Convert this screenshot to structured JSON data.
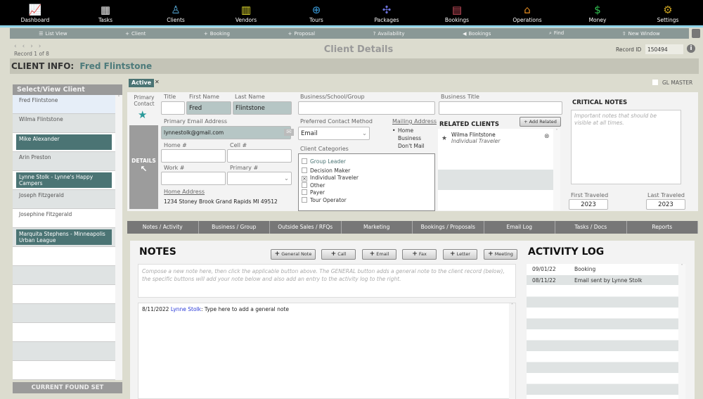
{
  "nav": [
    {
      "label": "Dashboard",
      "icon": "chart-icon",
      "color": "#ddd",
      "glyph": "📈"
    },
    {
      "label": "Tasks",
      "icon": "calendar-icon",
      "color": "#eee",
      "glyph": "▦"
    },
    {
      "label": "Clients",
      "icon": "person-icon",
      "color": "#5ab0e0",
      "glyph": "♙"
    },
    {
      "label": "Vendors",
      "icon": "building-icon",
      "color": "#e6e030",
      "glyph": "▥"
    },
    {
      "label": "Tours",
      "icon": "globe-icon",
      "color": "#3a9ad8",
      "glyph": "⊕"
    },
    {
      "label": "Packages",
      "icon": "puzzle-icon",
      "color": "#6a70d8",
      "glyph": "✣"
    },
    {
      "label": "Bookings",
      "icon": "ticket-icon",
      "color": "#d05060",
      "glyph": "▤"
    },
    {
      "label": "Operations",
      "icon": "house-icon",
      "color": "#e08a20",
      "glyph": "⌂"
    },
    {
      "label": "Money",
      "icon": "coin-icon",
      "color": "#30c050",
      "glyph": "$"
    },
    {
      "label": "Settings",
      "icon": "gears-icon",
      "color": "#c8a020",
      "glyph": "⚙"
    }
  ],
  "toolbar": [
    {
      "label": "List View",
      "glyph": "☰"
    },
    {
      "label": "Client",
      "glyph": "+"
    },
    {
      "label": "Booking",
      "glyph": "+"
    },
    {
      "label": "Proposal",
      "glyph": "+"
    },
    {
      "label": "Availability",
      "glyph": "?"
    },
    {
      "label": "Bookings",
      "glyph": "◀"
    },
    {
      "label": "Find",
      "glyph": "⌕"
    },
    {
      "label": "New Window",
      "glyph": "⇧"
    }
  ],
  "header": {
    "record": "Record 1 of 8",
    "title": "Client Details",
    "record_id_label": "Record ID",
    "record_id": "150494",
    "client_info_label": "CLIENT INFO:",
    "client_name": "Fred Flintstone"
  },
  "list": {
    "title": "Select/View Client",
    "footer": "CURRENT FOUND SET",
    "items": [
      {
        "name": "Fred Flintstone",
        "hl": false
      },
      {
        "name": "Wilma Flintstone",
        "hl": false
      },
      {
        "name": "Mike Alexander",
        "hl": true
      },
      {
        "name": "Arin Preston",
        "hl": false
      },
      {
        "name": "Lynne Stolk - Lynne's Happy Campers",
        "hl": true
      },
      {
        "name": "Joseph Fitzgerald",
        "hl": false
      },
      {
        "name": "Josephine Fitzgerald",
        "hl": false
      },
      {
        "name": "Marquita Stephens - Minneapolis Urban League",
        "hl": true
      }
    ]
  },
  "form": {
    "status": "Active",
    "gl_master": "GL MASTER",
    "primary_contact": "Primary Contact",
    "details": "DETAILS",
    "title_label": "Title",
    "title": "",
    "first_label": "First Name",
    "first": "Fred",
    "last_label": "Last Name",
    "last": "Flintstone",
    "business_label": "Business/School/Group",
    "business_title_label": "Business Title",
    "email_label": "Primary Email Address",
    "email": "lynnestolk@gmail.com",
    "home_label": "Home #",
    "cell_label": "Cell #",
    "work_label": "Work #",
    "primary_label": "Primary #",
    "home_address_label": "Home Address",
    "home_address": "1234 Stoney Brook  Grand Rapids MI 49512",
    "pref_label": "Preferred Contact Method",
    "pref": "Email",
    "mailing_label": "Mailing Address",
    "mailing_options": [
      "Home",
      "Business",
      "Don't Mail"
    ],
    "categories_label": "Client Categories",
    "categories": [
      {
        "label": "Group Leader",
        "checked": false
      },
      {
        "label": "Decision Maker",
        "checked": false
      },
      {
        "label": "Individual Traveler",
        "checked": true
      },
      {
        "label": "Other",
        "checked": false
      },
      {
        "label": "Payer",
        "checked": false
      },
      {
        "label": "Tour Operator",
        "checked": false
      }
    ],
    "related_label": "RELATED CLIENTS",
    "add_related": "Add Related",
    "related": [
      {
        "name": "Wilma Flintstone",
        "type": "Individual Traveler"
      }
    ],
    "critical_label": "CRITICAL NOTES",
    "critical_placeholder": "Important notes that should be visible at all times.",
    "first_traveled_label": "First Traveled",
    "first_traveled": "2023",
    "last_traveled_label": "Last Traveled",
    "last_traveled": "2023"
  },
  "tabs": [
    "Notes / Activity",
    "Business / Group",
    "Outside Sales / RFQs",
    "Marketing",
    "Bookings / Proposals",
    "Email Log",
    "Tasks / Docs",
    "Reports"
  ],
  "notes": {
    "title": "NOTES",
    "buttons": [
      "General Note",
      "Call",
      "Email",
      "Fax",
      "Letter",
      "Meeting"
    ],
    "compose_placeholder": "Compose a new note here, then click the applicable button above. The GENERAL button adds a general note to the client record (below), the specific buttons will add your note below and also add an entry to the activity log to the right.",
    "entry_date": "8/11/2022",
    "entry_author": "Lynne Stolk",
    "entry_text": ": Type here to add a general note"
  },
  "activity": {
    "title": "ACTIVITY LOG",
    "rows": [
      {
        "date": "09/01/22",
        "text": "Booking"
      },
      {
        "date": "08/11/22",
        "text": "Email sent by Lynne Stolk"
      }
    ]
  }
}
